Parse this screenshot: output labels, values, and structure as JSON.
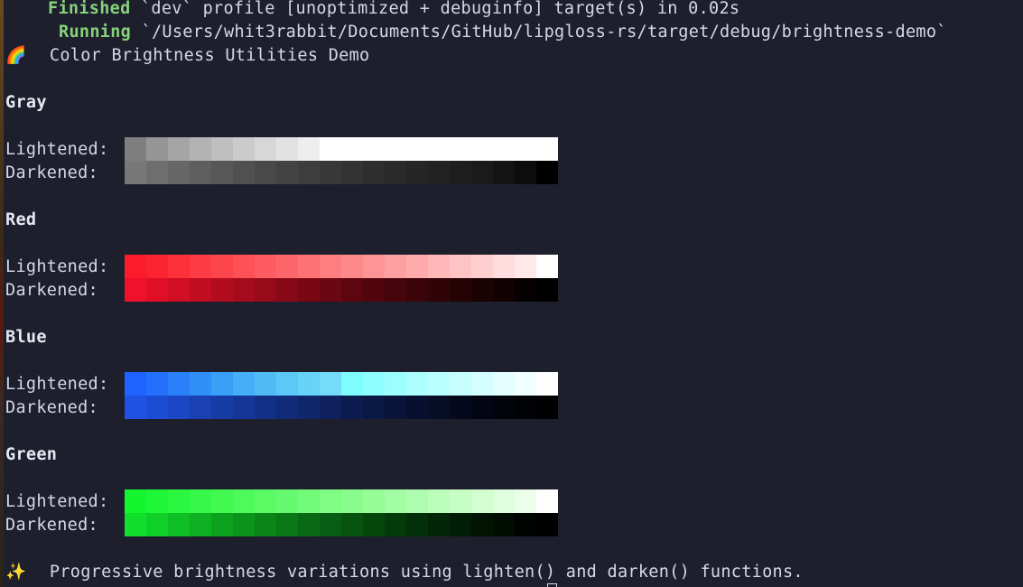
{
  "terminal": {
    "build_lines": [
      {
        "status": "Finished",
        "message": "`dev` profile [unoptimized + debuginfo] target(s) in 0.02s"
      },
      {
        "status": "Running",
        "message": "`/Users/whit3rabbit/Documents/GitHub/lipgloss-rs/target/debug/brightness-demo`"
      }
    ],
    "title_icon": "🌈",
    "title_icon_name": "rainbow-icon",
    "title": "Color Brightness Utilities Demo",
    "footer_icon": "✨",
    "footer_icon_name": "sparkles-icon",
    "footer": "Progressive brightness variations using lighten() and darken() functions."
  },
  "labels": {
    "lightened": "Lightened:",
    "darkened": "Darkened:"
  },
  "sections": [
    {
      "name": "Gray",
      "lightened": [
        "#7f7f7f",
        "#959595",
        "#a5a5a5",
        "#b3b3b3",
        "#bfbfbf",
        "#cbcbcb",
        "#d7d7d7",
        "#e2e2e2",
        "#eeeeee",
        "#ffffff",
        "#ffffff",
        "#ffffff",
        "#ffffff",
        "#ffffff",
        "#ffffff",
        "#ffffff",
        "#ffffff",
        "#ffffff",
        "#ffffff",
        "#ffffff"
      ],
      "darkened": [
        "#787878",
        "#6e6e6e",
        "#666666",
        "#5e5e5e",
        "#575757",
        "#505050",
        "#494949",
        "#434343",
        "#3d3d3d",
        "#383838",
        "#333333",
        "#2e2e2e",
        "#2a2a2a",
        "#262626",
        "#222222",
        "#1e1e1e",
        "#1a1a1a",
        "#141414",
        "#0c0c0c",
        "#000000"
      ]
    },
    {
      "name": "Red",
      "lightened": [
        "#fa1c2a",
        "#fb232f",
        "#fb3038",
        "#fc3b42",
        "#fc464c",
        "#fd5157",
        "#fd5c61",
        "#fd676b",
        "#fe7275",
        "#fe7d80",
        "#fe898b",
        "#fe9496",
        "#fe9fa1",
        "#ffabac",
        "#ffb7b8",
        "#ffc3c4",
        "#ffcfd0",
        "#ffdcdd",
        "#ffe9ea",
        "#ffffff"
      ],
      "darkened": [
        "#f0112a",
        "#e00f26",
        "#d10e24",
        "#c20d21",
        "#b30c1f",
        "#a40b1c",
        "#960a19",
        "#870917",
        "#790814",
        "#6b0712",
        "#5e0610",
        "#51050d",
        "#45050b",
        "#3a0409",
        "#2f0307",
        "#250305",
        "#1b0203",
        "#120102",
        "#080101",
        "#000000"
      ]
    },
    {
      "name": "Blue",
      "lightened": [
        "#1f62ff",
        "#2370fc",
        "#2a7ffa",
        "#3190f8",
        "#3a9ff7",
        "#44aff7",
        "#4fbcf6",
        "#5bc8f7",
        "#67d3f7",
        "#74dcf8",
        "#80fdfe",
        "#8ffefe",
        "#9dfefe",
        "#abffff",
        "#b9ffff",
        "#c7ffff",
        "#d5ffff",
        "#e3ffff",
        "#f1ffff",
        "#ffffff"
      ],
      "darkened": [
        "#1f52e3",
        "#1d4cd4",
        "#1b46c4",
        "#1941b4",
        "#173ba5",
        "#153696",
        "#133087",
        "#112b79",
        "#0f266b",
        "#0e215e",
        "#0c1c51",
        "#0a1845",
        "#091439",
        "#07102e",
        "#060d24",
        "#04091b",
        "#030612",
        "#02040b",
        "#010205",
        "#000000"
      ]
    },
    {
      "name": "Green",
      "lightened": [
        "#12f52f",
        "#1ef637",
        "#2af740",
        "#36f848",
        "#42f951",
        "#4efa5b",
        "#5afa65",
        "#66fb6f",
        "#72fb79",
        "#7efc84",
        "#8afc8e",
        "#96fd99",
        "#a2fda4",
        "#aefdaf",
        "#bafeba",
        "#c6fec6",
        "#d2fed2",
        "#defede",
        "#eafeea",
        "#ffffff"
      ],
      "darkened": [
        "#10e02b",
        "#0fd028",
        "#0ec025",
        "#0db122",
        "#0ca21f",
        "#0b941c",
        "#0a8619",
        "#097817",
        "#086b14",
        "#075e12",
        "#06520f",
        "#05460d",
        "#043b0b",
        "#033009",
        "#032607",
        "#021d05",
        "#011404",
        "#010c02",
        "#000501",
        "#000000"
      ]
    }
  ]
}
